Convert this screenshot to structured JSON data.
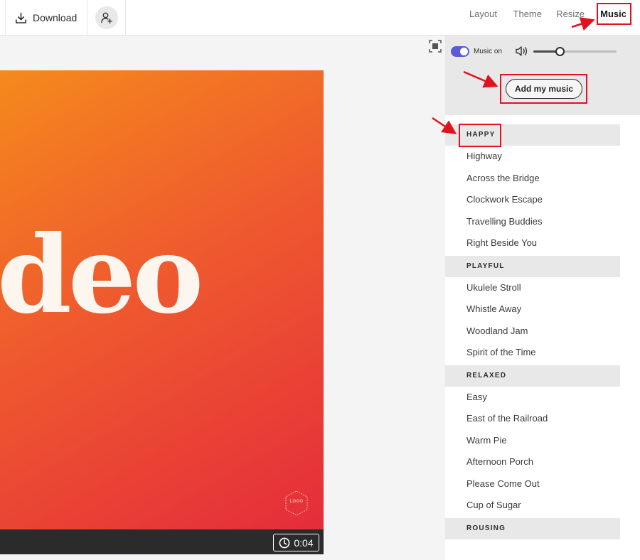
{
  "toolbar": {
    "download_label": "Download",
    "nav": [
      {
        "label": "Layout"
      },
      {
        "label": "Theme"
      },
      {
        "label": "Resize"
      },
      {
        "label": "Music",
        "active": true
      }
    ]
  },
  "canvas": {
    "slide_text": "deo",
    "logo_badge": "LOGO",
    "timer": "0:04",
    "gradient_colors": [
      "#f58a1c",
      "#ef5a2e",
      "#e42d3b"
    ]
  },
  "music_panel": {
    "toggle_label": "Music on",
    "toggle_on": true,
    "volume_fraction": 0.32,
    "add_music_label": "Add my music",
    "categories": [
      {
        "name": "HAPPY",
        "tracks": [
          "Highway",
          "Across the Bridge",
          "Clockwork Escape",
          "Travelling Buddies",
          "Right Beside You"
        ]
      },
      {
        "name": "PLAYFUL",
        "tracks": [
          "Ukulele Stroll",
          "Whistle Away",
          "Woodland Jam",
          "Spirit of the Time"
        ]
      },
      {
        "name": "RELAXED",
        "tracks": [
          "Easy",
          "East of the Railroad",
          "Warm Pie",
          "Afternoon Porch",
          "Please Come Out",
          "Cup of Sugar"
        ]
      },
      {
        "name": "ROUSING",
        "tracks": []
      }
    ]
  },
  "colors": {
    "annotation": "#e0121f",
    "toggle_accent": "#5b5bd6"
  }
}
